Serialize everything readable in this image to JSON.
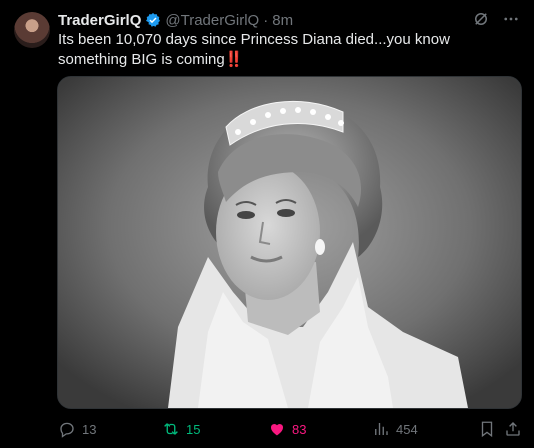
{
  "tweet": {
    "display_name": "TraderGirlQ",
    "handle": "@TraderGirlQ",
    "separator": "·",
    "time": "8m",
    "text": "Its been 10,070 days since Princess Diana died...you know something BIG is coming",
    "text_emoji": "‼️",
    "media_icon": "photo-black-and-white-portrait"
  },
  "actions": {
    "replies": "13",
    "retweets": "15",
    "likes": "83",
    "views": "454"
  },
  "colors": {
    "background": "#000000",
    "text": "#e7e9ea",
    "muted": "#71767b",
    "verified": "#1d9bf0",
    "retweet": "#00ba7c",
    "like": "#f91880"
  },
  "icons": {
    "verified": "verified-badge-icon",
    "grok": "grok-icon",
    "more": "more-icon",
    "reply": "reply-icon",
    "retweet": "retweet-icon",
    "like": "heart-icon",
    "views": "views-icon",
    "bookmark": "bookmark-icon",
    "share": "share-icon"
  }
}
